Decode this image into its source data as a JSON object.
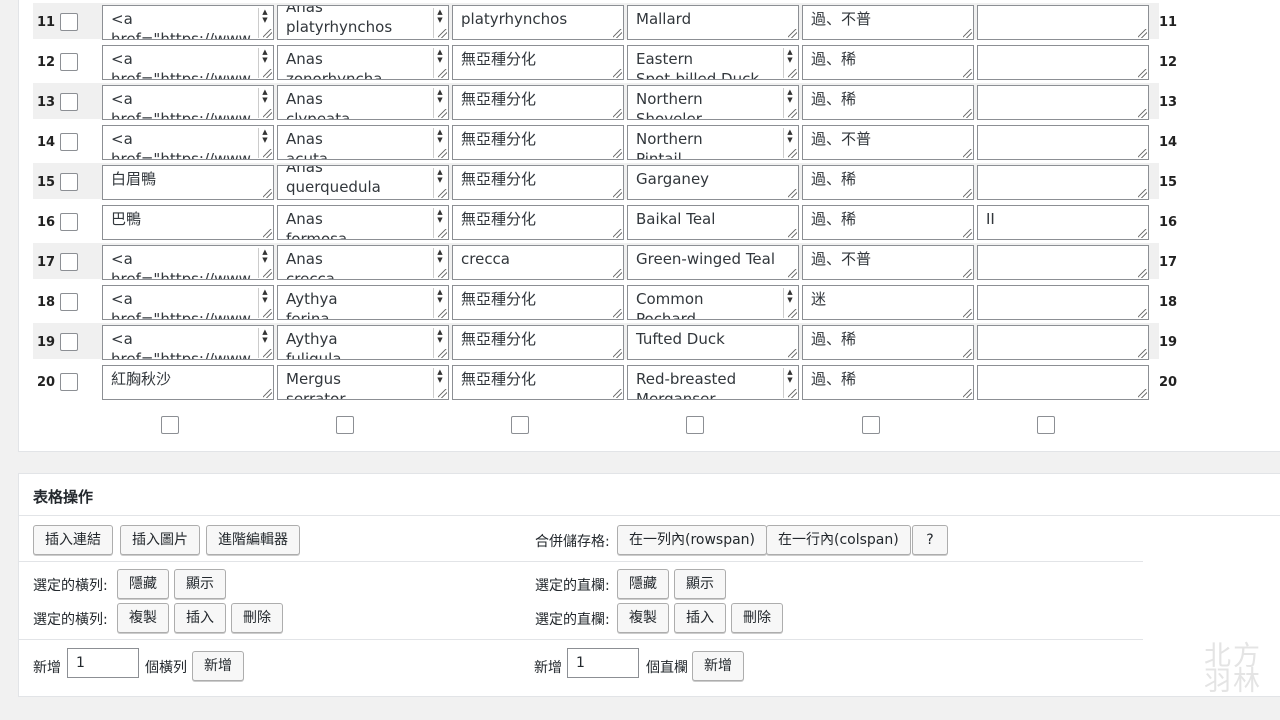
{
  "table": {
    "rows": [
      {
        "num": "11",
        "cells": [
          {
            "text": "<a\nhref=\"https://www.f",
            "spin": true
          },
          {
            "text": "Anas\nplatyrhynchos",
            "spin": true,
            "offset": -12
          },
          {
            "text": "platyrhynchos",
            "spin": false
          },
          {
            "text": "Mallard",
            "spin": false
          },
          {
            "text": "過、不普",
            "spin": false
          },
          {
            "text": "",
            "spin": false
          }
        ]
      },
      {
        "num": "12",
        "cells": [
          {
            "text": "<a\nhref=\"https://www.f",
            "spin": true
          },
          {
            "text": "Anas\nzonorhyncha",
            "spin": true
          },
          {
            "text": "無亞種分化",
            "spin": false
          },
          {
            "text": "Eastern\nSpot-billed Duck",
            "spin": true
          },
          {
            "text": "過、稀",
            "spin": false
          },
          {
            "text": "",
            "spin": false
          }
        ]
      },
      {
        "num": "13",
        "cells": [
          {
            "text": "<a\nhref=\"https://www.f",
            "spin": true
          },
          {
            "text": "Anas\nclypeata",
            "spin": true
          },
          {
            "text": "無亞種分化",
            "spin": false
          },
          {
            "text": "Northern\nShoveler",
            "spin": true
          },
          {
            "text": "過、稀",
            "spin": false
          },
          {
            "text": "",
            "spin": false
          }
        ]
      },
      {
        "num": "14",
        "cells": [
          {
            "text": "<a\nhref=\"https://www.f",
            "spin": true
          },
          {
            "text": "Anas\nacuta",
            "spin": true
          },
          {
            "text": "無亞種分化",
            "spin": false
          },
          {
            "text": "Northern\nPintail",
            "spin": true
          },
          {
            "text": "過、不普",
            "spin": false
          },
          {
            "text": "",
            "spin": false
          }
        ]
      },
      {
        "num": "15",
        "cells": [
          {
            "text": "白眉鴨",
            "spin": false
          },
          {
            "text": "Anas\nquerquedula",
            "spin": true,
            "offset": -12
          },
          {
            "text": "無亞種分化",
            "spin": false
          },
          {
            "text": "Garganey",
            "spin": false
          },
          {
            "text": "過、稀",
            "spin": false
          },
          {
            "text": "",
            "spin": false
          }
        ]
      },
      {
        "num": "16",
        "cells": [
          {
            "text": "巴鴨",
            "spin": false
          },
          {
            "text": "Anas\nformosa",
            "spin": true
          },
          {
            "text": "無亞種分化",
            "spin": false
          },
          {
            "text": "Baikal Teal",
            "spin": false
          },
          {
            "text": "過、稀",
            "spin": false
          },
          {
            "text": "II",
            "spin": false
          }
        ]
      },
      {
        "num": "17",
        "cells": [
          {
            "text": "<a\nhref=\"https://www.f",
            "spin": true
          },
          {
            "text": "Anas\ncrecca",
            "spin": true
          },
          {
            "text": "crecca",
            "spin": false
          },
          {
            "text": "Green-winged Teal",
            "spin": false
          },
          {
            "text": "過、不普",
            "spin": false
          },
          {
            "text": "",
            "spin": false
          }
        ]
      },
      {
        "num": "18",
        "cells": [
          {
            "text": "<a\nhref=\"https://www.f",
            "spin": true
          },
          {
            "text": "Aythya\nferina",
            "spin": true
          },
          {
            "text": "無亞種分化",
            "spin": false
          },
          {
            "text": "Common\nPochard",
            "spin": true
          },
          {
            "text": "迷",
            "spin": false
          },
          {
            "text": "",
            "spin": false
          }
        ]
      },
      {
        "num": "19",
        "cells": [
          {
            "text": "<a\nhref=\"https://www.f",
            "spin": true
          },
          {
            "text": "Aythya\nfuligula",
            "spin": true
          },
          {
            "text": "無亞種分化",
            "spin": false
          },
          {
            "text": "Tufted Duck",
            "spin": false
          },
          {
            "text": "過、稀",
            "spin": false
          },
          {
            "text": "",
            "spin": false
          }
        ]
      },
      {
        "num": "20",
        "cells": [
          {
            "text": "紅胸秋沙",
            "spin": false
          },
          {
            "text": "Mergus\nserrator",
            "spin": true
          },
          {
            "text": "無亞種分化",
            "spin": false
          },
          {
            "text": "Red-breasted\nMerganser",
            "spin": true
          },
          {
            "text": "過、稀",
            "spin": false
          },
          {
            "text": "",
            "spin": false
          }
        ]
      }
    ]
  },
  "ops": {
    "title": "表格操作",
    "insert_link": "插入連結",
    "insert_image": "插入圖片",
    "advanced_editor": "進階編輯器",
    "merge_label": "合併儲存格:",
    "rowspan": "在一列內(rowspan)",
    "colspan": "在一行內(colspan)",
    "help": "?",
    "selected_rows": "選定的橫列:",
    "selected_cols": "選定的直欄:",
    "hide": "隱藏",
    "show": "顯示",
    "copy": "複製",
    "insert": "插入",
    "delete": "刪除",
    "add": "新增",
    "add_rows_value": "1",
    "rows_unit": "個橫列",
    "add_cols_value": "1",
    "cols_unit": "個直欄"
  },
  "watermark": "北方\n羽林"
}
